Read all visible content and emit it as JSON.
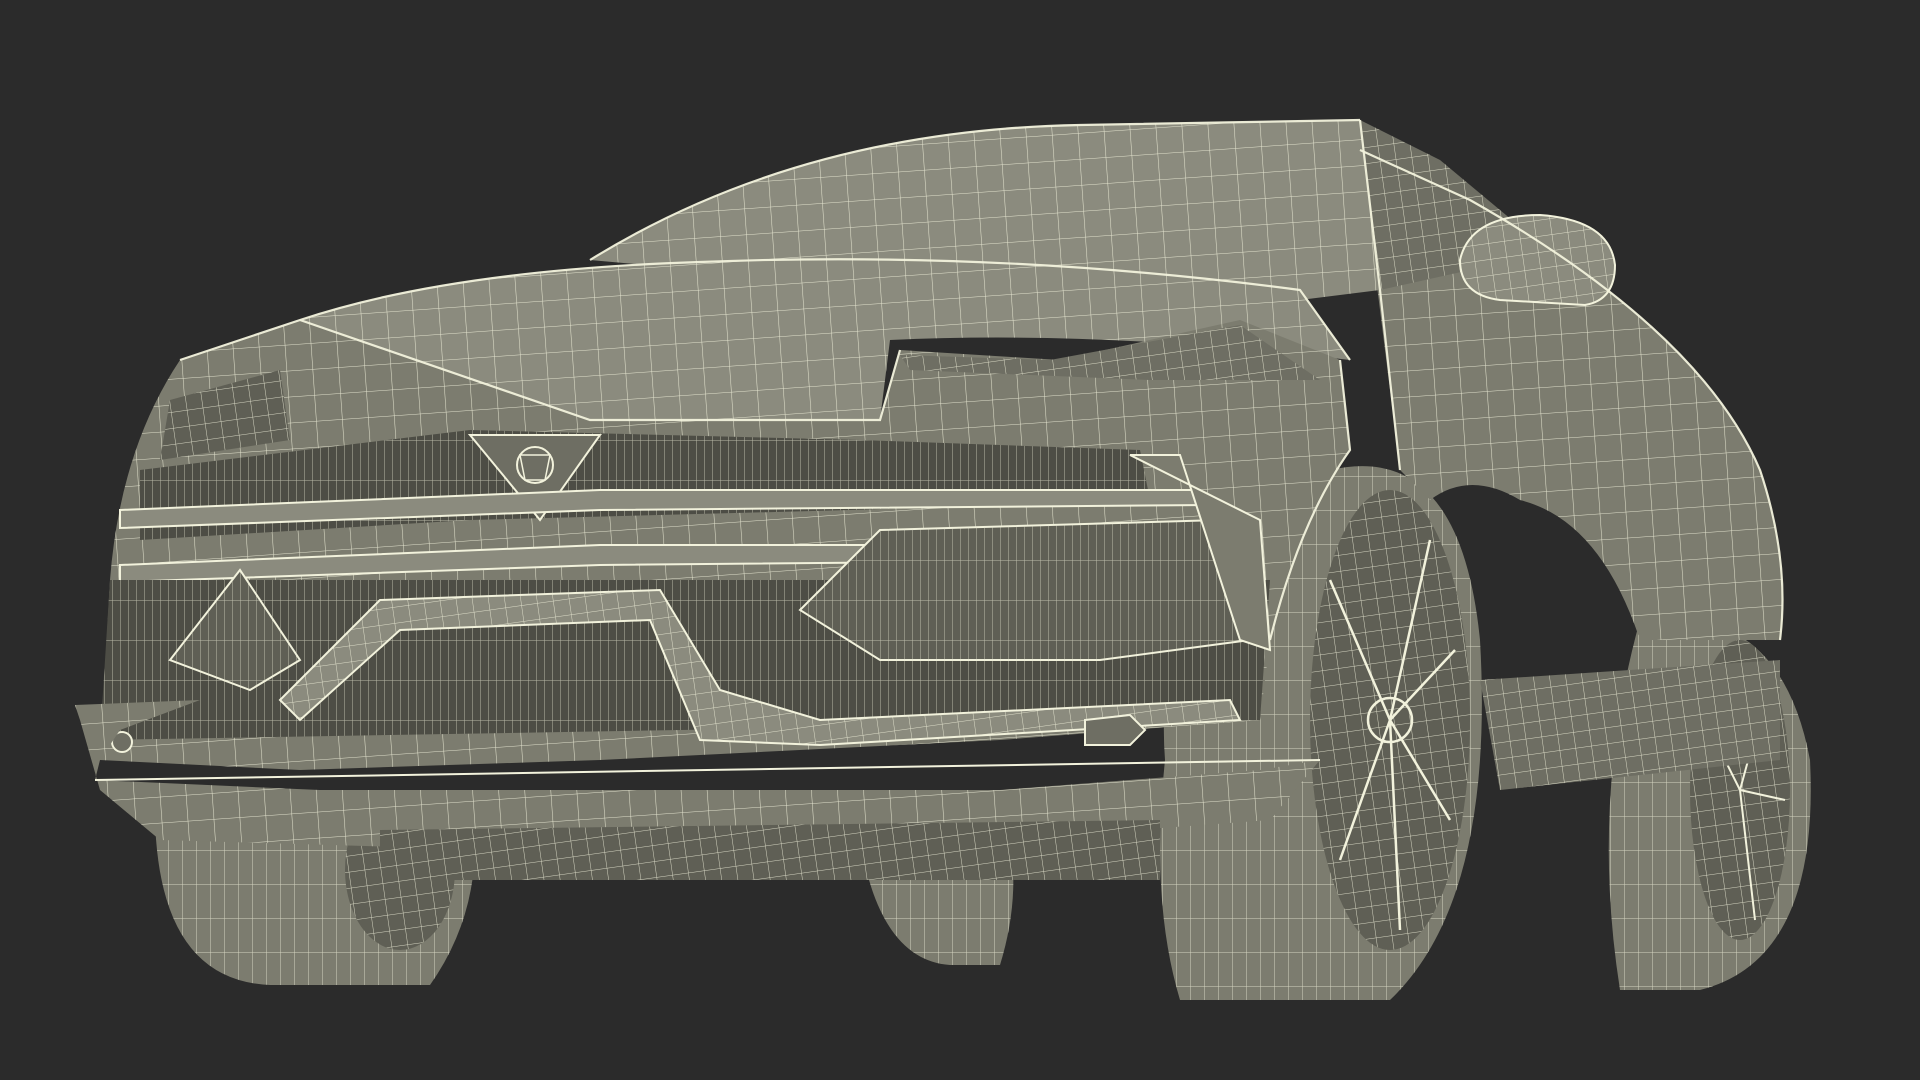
{
  "scene": {
    "subject": "car-wireframe-render",
    "colors": {
      "background": "#2b2b2b",
      "shell": "#7c7c6f",
      "shell_light": "#8b8b7e",
      "shell_dark": "#5f5f55",
      "cavity": "#4d4d45",
      "wire": "#f2f2dc"
    },
    "tire_count": 4
  }
}
